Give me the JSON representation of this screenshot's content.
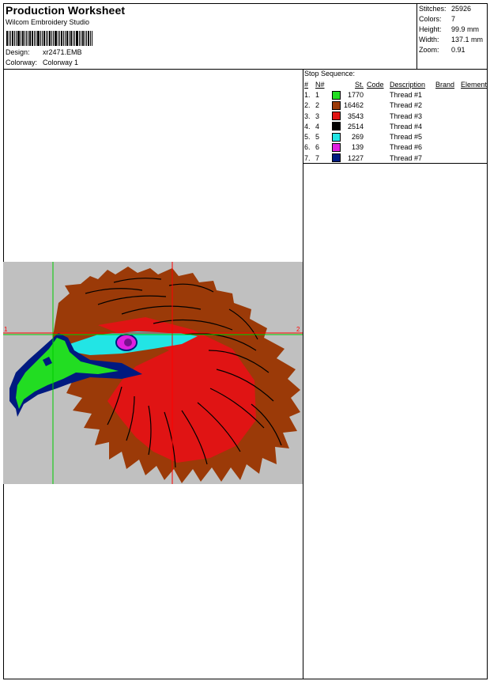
{
  "header": {
    "title": "Production Worksheet",
    "software": "Wilcom Embroidery Studio",
    "design_label": "Design:",
    "design_value": "xr2471.EMB",
    "colorway_label": "Colorway:",
    "colorway_value": "Colorway 1"
  },
  "stats": {
    "stitches_label": "Stitches:",
    "stitches_value": "25926",
    "colors_label": "Colors:",
    "colors_value": "7",
    "height_label": "Height:",
    "height_value": "99.9 mm",
    "width_label": "Width:",
    "width_value": "137.1 mm",
    "zoom_label": "Zoom:",
    "zoom_value": "0.91"
  },
  "sequence": {
    "title": "Stop Sequence:",
    "headers": {
      "idx": "#",
      "n": "N#",
      "st": "St.",
      "code": "Code",
      "desc": "Description",
      "brand": "Brand",
      "element": "Element"
    },
    "rows": [
      {
        "idx": "1.",
        "n": "1",
        "color": "#22dd22",
        "st": "1770",
        "desc": "Thread #1"
      },
      {
        "idx": "2.",
        "n": "2",
        "color": "#9b3a08",
        "st": "16462",
        "desc": "Thread #2"
      },
      {
        "idx": "3.",
        "n": "3",
        "color": "#e01414",
        "st": "3543",
        "desc": "Thread #3"
      },
      {
        "idx": "4.",
        "n": "4",
        "color": "#000000",
        "st": "2514",
        "desc": "Thread #4"
      },
      {
        "idx": "5.",
        "n": "5",
        "color": "#22e5e5",
        "st": "269",
        "desc": "Thread #5"
      },
      {
        "idx": "6.",
        "n": "6",
        "color": "#e020e0",
        "st": "139",
        "desc": "Thread #6"
      },
      {
        "idx": "7.",
        "n": "7",
        "color": "#001a80",
        "st": "1227",
        "desc": "Thread #7"
      }
    ]
  },
  "design_view": {
    "background": "#c0c0c0",
    "guide_vertical_color": "#00cc00",
    "guide_horizontal_color": "#ff0000",
    "marker_left": "1",
    "marker_right": "2"
  }
}
